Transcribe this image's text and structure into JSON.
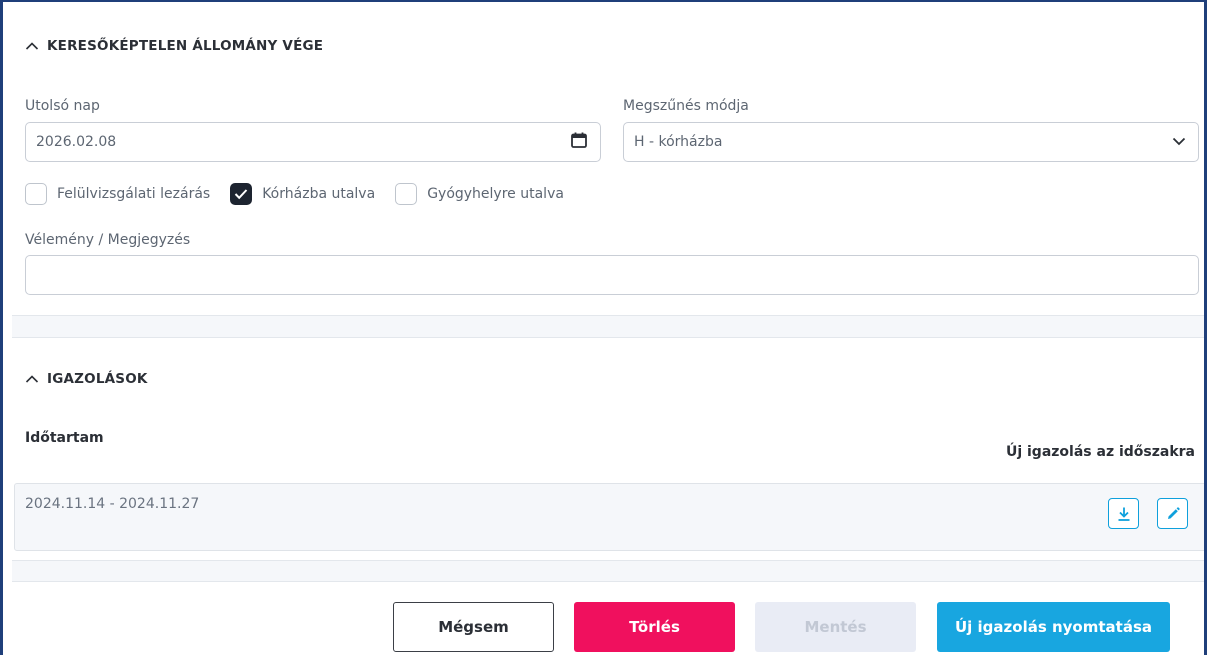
{
  "section_end": {
    "title": "KERESŐKÉPTELEN ÁLLOMÁNY VÉGE",
    "last_day_label": "Utolsó nap",
    "last_day_value": "2026.02.08",
    "termination_label": "Megszűnés módja",
    "termination_value": "H - kórházba",
    "checkboxes": [
      {
        "label": "Felülvizsgálati lezárás",
        "checked": false
      },
      {
        "label": "Kórházba utalva",
        "checked": true
      },
      {
        "label": "Gyógyhelyre utalva",
        "checked": false
      }
    ],
    "opinion_label": "Vélemény / Megjegyzés",
    "opinion_value": ""
  },
  "section_certs": {
    "title": "IGAZOLÁSOK",
    "duration_header": "Időtartam",
    "new_cert_header": "Új igazolás az időszakra",
    "rows": [
      {
        "period": "2024.11.14 - 2024.11.27",
        "icons": [
          "download-icon",
          "edit-icon"
        ]
      }
    ]
  },
  "footer": {
    "cancel_label": "Mégsem",
    "delete_label": "Törlés",
    "save_label": "Mentés",
    "print_label": "Új igazolás nyomtatása"
  },
  "colors": {
    "frame": "#1f3f7a",
    "delete": "#f0105e",
    "primary": "#18a6e0",
    "disabled": "#e9ecf5"
  }
}
